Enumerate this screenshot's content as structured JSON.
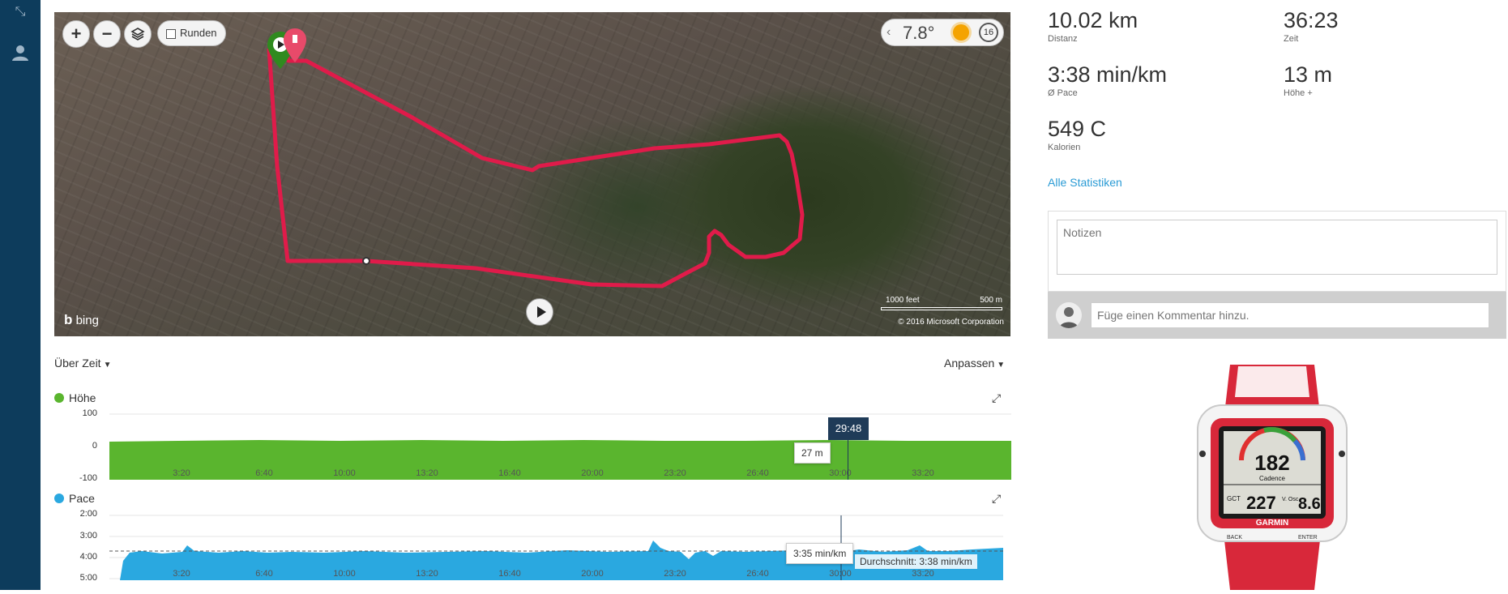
{
  "map": {
    "laps_label": "Runden",
    "temperature": "7.8°",
    "wind": "16",
    "bing_logo": "bing",
    "scale_feet": "1000 feet",
    "scale_meters": "500 m",
    "copyright": "© 2016 Microsoft Corporation"
  },
  "controls": {
    "view_mode": "Über Zeit",
    "customize": "Anpassen"
  },
  "elevation_chart": {
    "title": "Höhe",
    "color": "#5ab52e",
    "yticks": [
      "100",
      "0",
      "-100"
    ],
    "xticks": [
      "3:20",
      "6:40",
      "10:00",
      "13:20",
      "16:40",
      "20:00",
      "23:20",
      "26:40",
      "30:00",
      "33:20"
    ],
    "tooltip": "27 m",
    "time_label": "29:48"
  },
  "pace_chart": {
    "title": "Pace",
    "color": "#2aa8e0",
    "yticks": [
      "2:00",
      "3:00",
      "4:00",
      "5:00"
    ],
    "xticks": [
      "3:20",
      "6:40",
      "10:00",
      "13:20",
      "16:40",
      "20:00",
      "23:20",
      "26:40",
      "30:00",
      "33:20"
    ],
    "tooltip": "3:35 min/km",
    "average_label": "Durchschnitt: 3:38 min/km"
  },
  "stats": [
    {
      "value": "10.02 km",
      "label": "Distanz"
    },
    {
      "value": "36:23",
      "label": "Zeit"
    },
    {
      "value": "3:38 min/km",
      "label": "Ø Pace"
    },
    {
      "value": "13 m",
      "label": "Höhe +"
    },
    {
      "value": "549 C",
      "label": "Kalorien"
    }
  ],
  "all_stats_link": "Alle Statistiken",
  "notes_placeholder": "Notizen",
  "comment_placeholder": "Füge einen Kommentar hinzu.",
  "watch": {
    "cadence": "182",
    "cadence_label": "Cadence",
    "gct": "227",
    "gct_label": "GCT",
    "vosc": "8.6",
    "vosc_label": "V. Osc",
    "brand": "GARMIN",
    "back_label": "BACK",
    "enter_label": "ENTER"
  }
}
